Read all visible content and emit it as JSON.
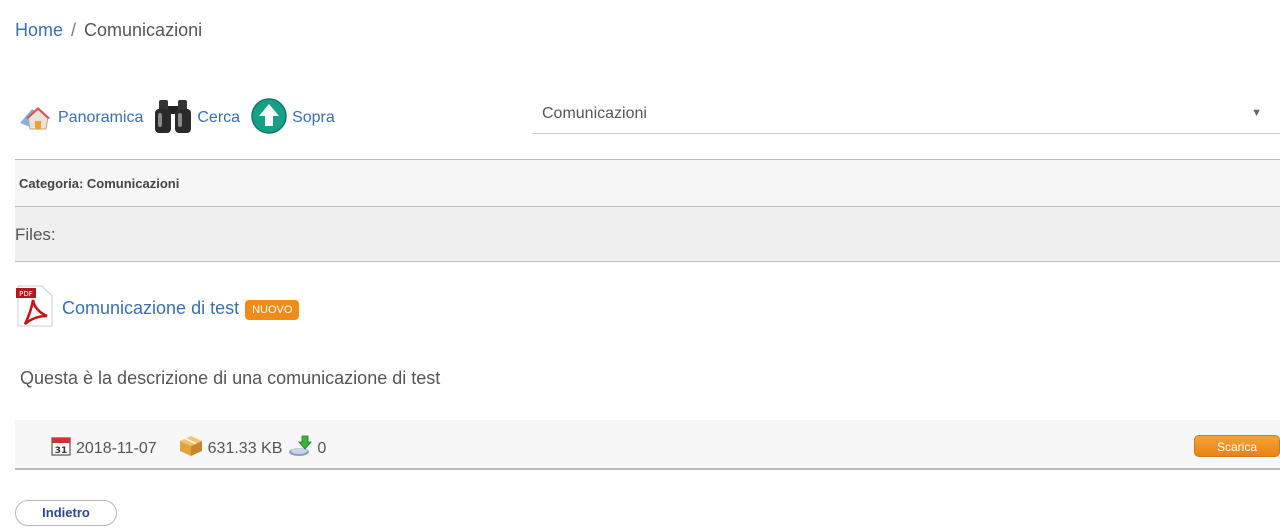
{
  "breadcrumb": {
    "home": "Home",
    "separator": "/",
    "current": "Comunicazioni"
  },
  "toolbar": {
    "overview_label": "Panoramica",
    "search_label": "Cerca",
    "up_label": "Sopra"
  },
  "category_select": {
    "value": "Comunicazioni",
    "arrow": "▼"
  },
  "category_heading": "Categoria: Comunicazioni",
  "files_heading": "Files:",
  "file": {
    "title": "Comunicazione di test",
    "badge": "NUOVO",
    "description": "Questa è la descrizione di una comunicazione di test",
    "calendar_day": "31",
    "date": "2018-11-07",
    "size": "631.33 KB",
    "downloads": "0",
    "download_button": "Scarica",
    "pdf_icon_text": "PDF"
  },
  "back_button": "Indietro",
  "colors": {
    "link": "#3a6fb0",
    "badge": "#f08c1a",
    "accent": "#e88310"
  }
}
